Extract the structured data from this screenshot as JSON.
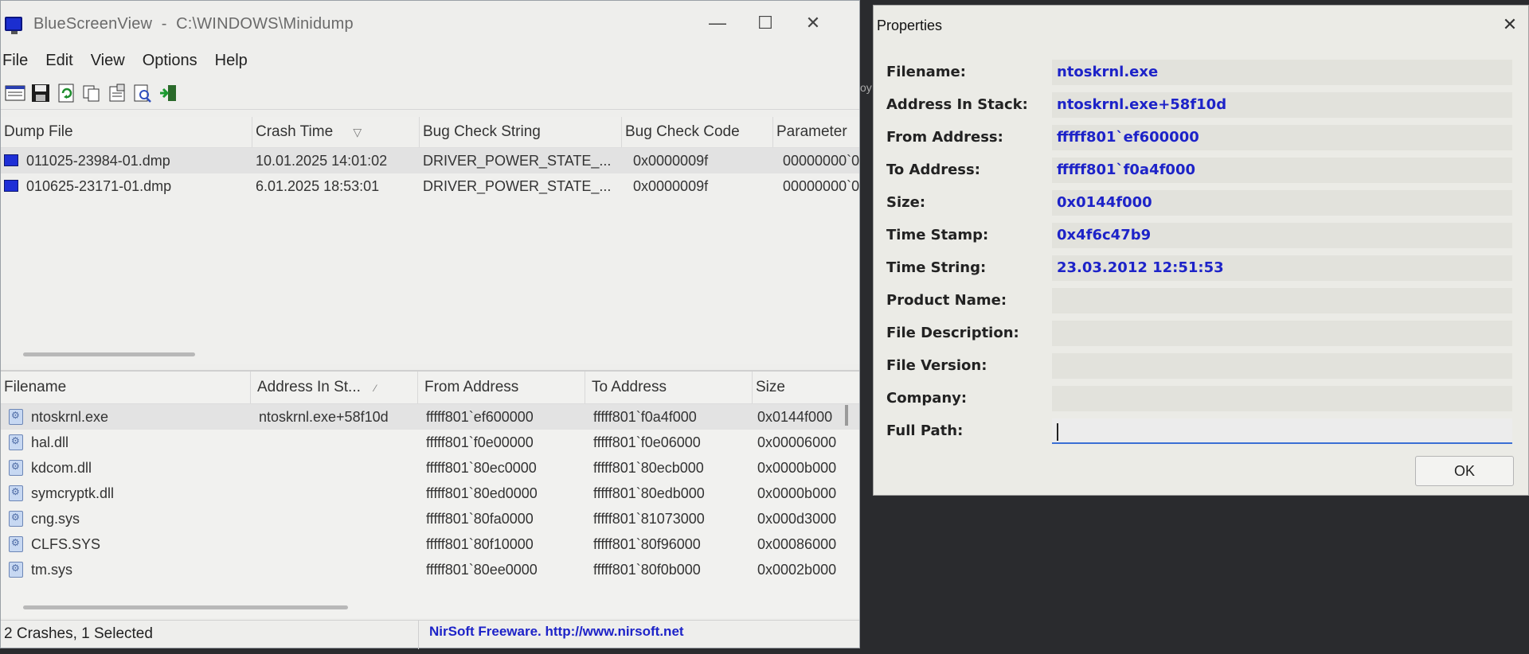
{
  "main": {
    "title": "BlueScreenView  -  C:\\WINDOWS\\Minidump",
    "menu": [
      "File",
      "Edit",
      "View",
      "Options",
      "Help"
    ],
    "toolbar_icons": [
      "export-html-icon",
      "save-icon",
      "refresh-icon",
      "copy-icon",
      "properties-icon",
      "find-icon",
      "exit-icon"
    ],
    "crash_columns": [
      "Dump File",
      "Crash Time",
      "Bug Check String",
      "Bug Check Code",
      "Parameter"
    ],
    "crash_rows": [
      {
        "dump": "011025-23984-01.dmp",
        "time": "10.01.2025 14:01:02",
        "bcstring": "DRIVER_POWER_STATE_...",
        "bccode": "0x0000009f",
        "param": "00000000`0"
      },
      {
        "dump": "010625-23171-01.dmp",
        "time": "6.01.2025 18:53:01",
        "bcstring": "DRIVER_POWER_STATE_...",
        "bccode": "0x0000009f",
        "param": "00000000`0"
      }
    ],
    "module_columns": [
      "Filename",
      "Address In St...",
      "From Address",
      "To Address",
      "Size"
    ],
    "module_rows": [
      {
        "file": "ntoskrnl.exe",
        "addr": "ntoskrnl.exe+58f10d",
        "from": "fffff801`ef600000",
        "to": "fffff801`f0a4f000",
        "size": "0x0144f000"
      },
      {
        "file": "hal.dll",
        "addr": "",
        "from": "fffff801`f0e00000",
        "to": "fffff801`f0e06000",
        "size": "0x00006000"
      },
      {
        "file": "kdcom.dll",
        "addr": "",
        "from": "fffff801`80ec0000",
        "to": "fffff801`80ecb000",
        "size": "0x0000b000"
      },
      {
        "file": "symcryptk.dll",
        "addr": "",
        "from": "fffff801`80ed0000",
        "to": "fffff801`80edb000",
        "size": "0x0000b000"
      },
      {
        "file": "cng.sys",
        "addr": "",
        "from": "fffff801`80fa0000",
        "to": "fffff801`81073000",
        "size": "0x000d3000"
      },
      {
        "file": "CLFS.SYS",
        "addr": "",
        "from": "fffff801`80f10000",
        "to": "fffff801`80f96000",
        "size": "0x00086000"
      },
      {
        "file": "tm.sys",
        "addr": "",
        "from": "fffff801`80ee0000",
        "to": "fffff801`80f0b000",
        "size": "0x0002b000"
      }
    ],
    "status": "2 Crashes, 1 Selected",
    "credit": "NirSoft Freeware.  http://www.nirsoft.net"
  },
  "props": {
    "title": "Properties",
    "fields": [
      {
        "label": "Filename:",
        "value": "ntoskrnl.exe"
      },
      {
        "label": "Address In Stack:",
        "value": "ntoskrnl.exe+58f10d"
      },
      {
        "label": "From Address:",
        "value": "fffff801`ef600000"
      },
      {
        "label": "To Address:",
        "value": "fffff801`f0a4f000"
      },
      {
        "label": "Size:",
        "value": "0x0144f000"
      },
      {
        "label": "Time Stamp:",
        "value": "0x4f6c47b9"
      },
      {
        "label": "Time String:",
        "value": "23.03.2012 12:51:53"
      },
      {
        "label": "Product Name:",
        "value": ""
      },
      {
        "label": "File Description:",
        "value": ""
      },
      {
        "label": "File Version:",
        "value": ""
      },
      {
        "label": "Company:",
        "value": ""
      },
      {
        "label": "Full Path:",
        "value": ""
      }
    ],
    "ok_label": "OK"
  },
  "background_glyph": "oy"
}
